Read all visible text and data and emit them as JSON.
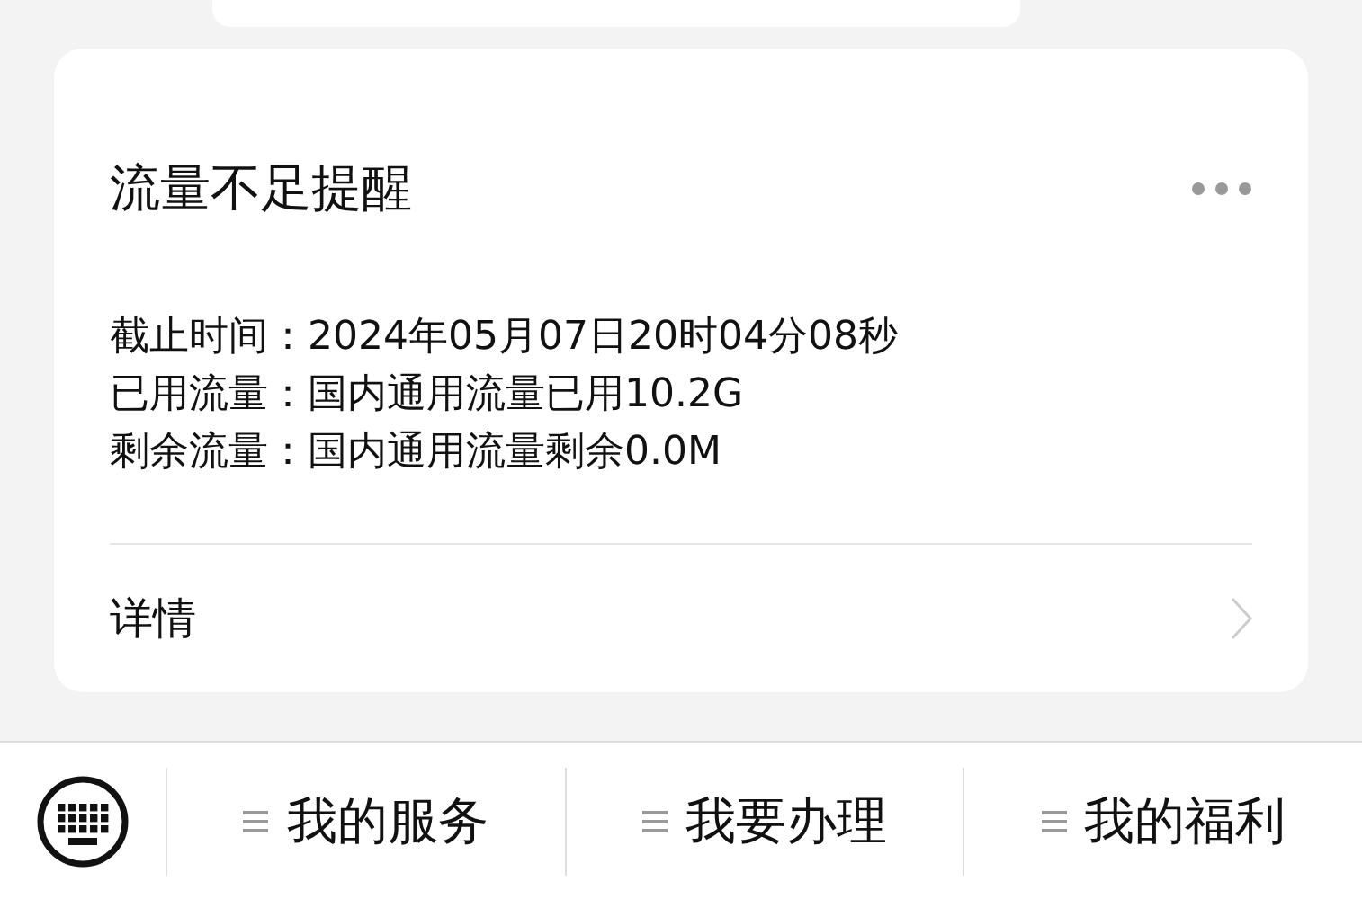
{
  "card": {
    "title": "流量不足提醒",
    "info": [
      {
        "label": "截止时间：",
        "value": "2024年05月07日20时04分08秒"
      },
      {
        "label": "已用流量：",
        "value": "国内通用流量已用10.2G"
      },
      {
        "label": "剩余流量：",
        "value": "国内通用流量剩余0.0M"
      }
    ],
    "link": "详情"
  },
  "menu_bar": {
    "items": [
      "我的服务",
      "我要办理",
      "我的福利"
    ]
  }
}
